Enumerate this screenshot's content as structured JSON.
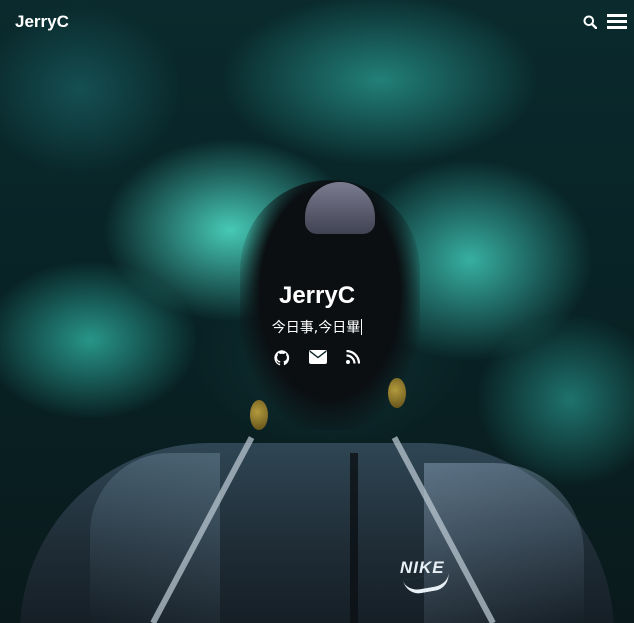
{
  "navbar": {
    "logo": "JerryC",
    "icons": [
      "search-icon",
      "menu-icon"
    ]
  },
  "hero": {
    "title": "JerryC",
    "subtitle": "今日事,今日畢",
    "social_icons": [
      "github-icon",
      "mail-icon",
      "rss-icon"
    ]
  },
  "background": {
    "jacket_brand_text": "NIKE"
  },
  "colors": {
    "text": "#ffffff",
    "smoke": "#4ad2be",
    "background": "#0a2a2d"
  }
}
